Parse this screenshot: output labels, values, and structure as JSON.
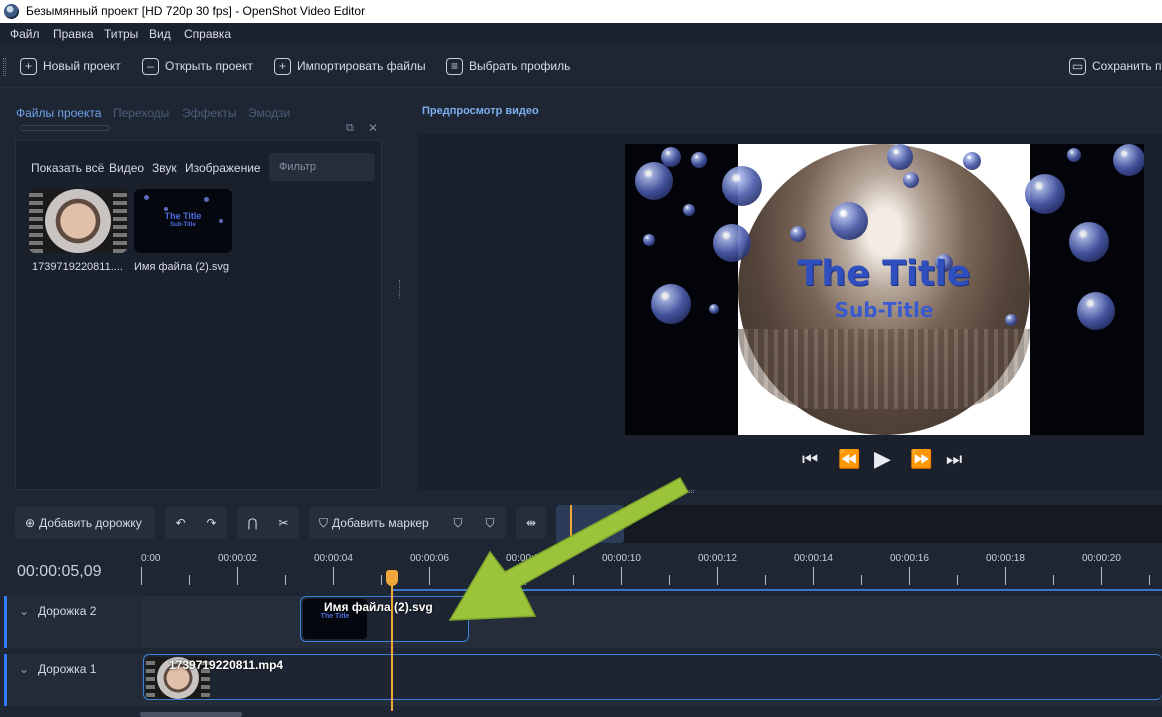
{
  "window": {
    "title": "Безымянный проект [HD 720p 30 fps] - OpenShot Video Editor"
  },
  "menu": [
    "Файл",
    "Правка",
    "Титры",
    "Вид",
    "Справка"
  ],
  "toolbar": {
    "new_project": "Новый проект",
    "open_project": "Открыть проект",
    "import_files": "Импортировать файлы",
    "choose_profile": "Выбрать профиль",
    "save_project": "Сохранить проект"
  },
  "left_tabs": [
    "Файлы проекта",
    "Переходы",
    "Эффекты",
    "Эмодзи"
  ],
  "filters": {
    "show_all": "Показать всё",
    "video": "Видео",
    "audio": "Звук",
    "image": "Изображение",
    "search_placeholder": "Фильтр"
  },
  "files": [
    {
      "name": "1739719220811...."
    },
    {
      "name": "Имя файла (2).svg",
      "title_text": "The Title",
      "subtitle_text": "Sub-Title"
    }
  ],
  "preview": {
    "title": "Предпросмотр видео",
    "video_title": "The Title",
    "video_subtitle": "Sub-Title"
  },
  "timeline_toolbar": {
    "add_track": "Добавить дорожку",
    "add_marker": "Добавить маркер"
  },
  "timeline": {
    "current_time": "00:00:05,09",
    "ruler_labels": [
      "0:00",
      "00:00:02",
      "00:00:04",
      "00:00:06",
      "00:00:08",
      "00:00:10",
      "00:00:12",
      "00:00:14",
      "00:00:16",
      "00:00:18",
      "00:00:20"
    ],
    "tracks": [
      {
        "name": "Дорожка 2",
        "clip": "Имя файла (2).svg"
      },
      {
        "name": "Дорожка 1",
        "clip": "1739719220811.mp4"
      }
    ]
  },
  "colors": {
    "accent": "#2f7df0",
    "playhead": "#f0a73a",
    "annotation_arrow": "#9cc43a"
  }
}
